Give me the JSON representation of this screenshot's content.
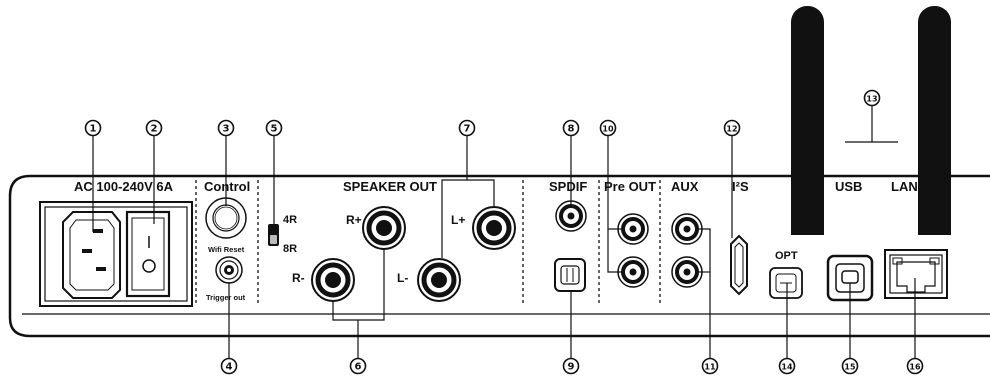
{
  "sections": {
    "ac": "AC 100-240V 6A",
    "control": "Control",
    "speaker_out": "SPEAKER OUT",
    "spdif": "SPDIF",
    "pre_out": "Pre OUT",
    "aux": "AUX",
    "i2s": "I²S",
    "usb": "USB",
    "lan": "LAN"
  },
  "port_labels": {
    "wifi_reset": "Wifi Reset",
    "trigger_out": "Trigger out",
    "ohm_4": "4R",
    "ohm_8": "8R",
    "r_plus": "R+",
    "r_minus": "R-",
    "l_plus": "L+",
    "l_minus": "L-",
    "opt": "OPT",
    "power_switch": "I"
  },
  "callouts": [
    "1",
    "2",
    "3",
    "4",
    "5",
    "6",
    "7",
    "8",
    "9",
    "10",
    "11",
    "12",
    "13",
    "14",
    "15",
    "16"
  ],
  "colors": {
    "outline": "#111111",
    "antenna": "#111111",
    "background": "#ffffff"
  }
}
